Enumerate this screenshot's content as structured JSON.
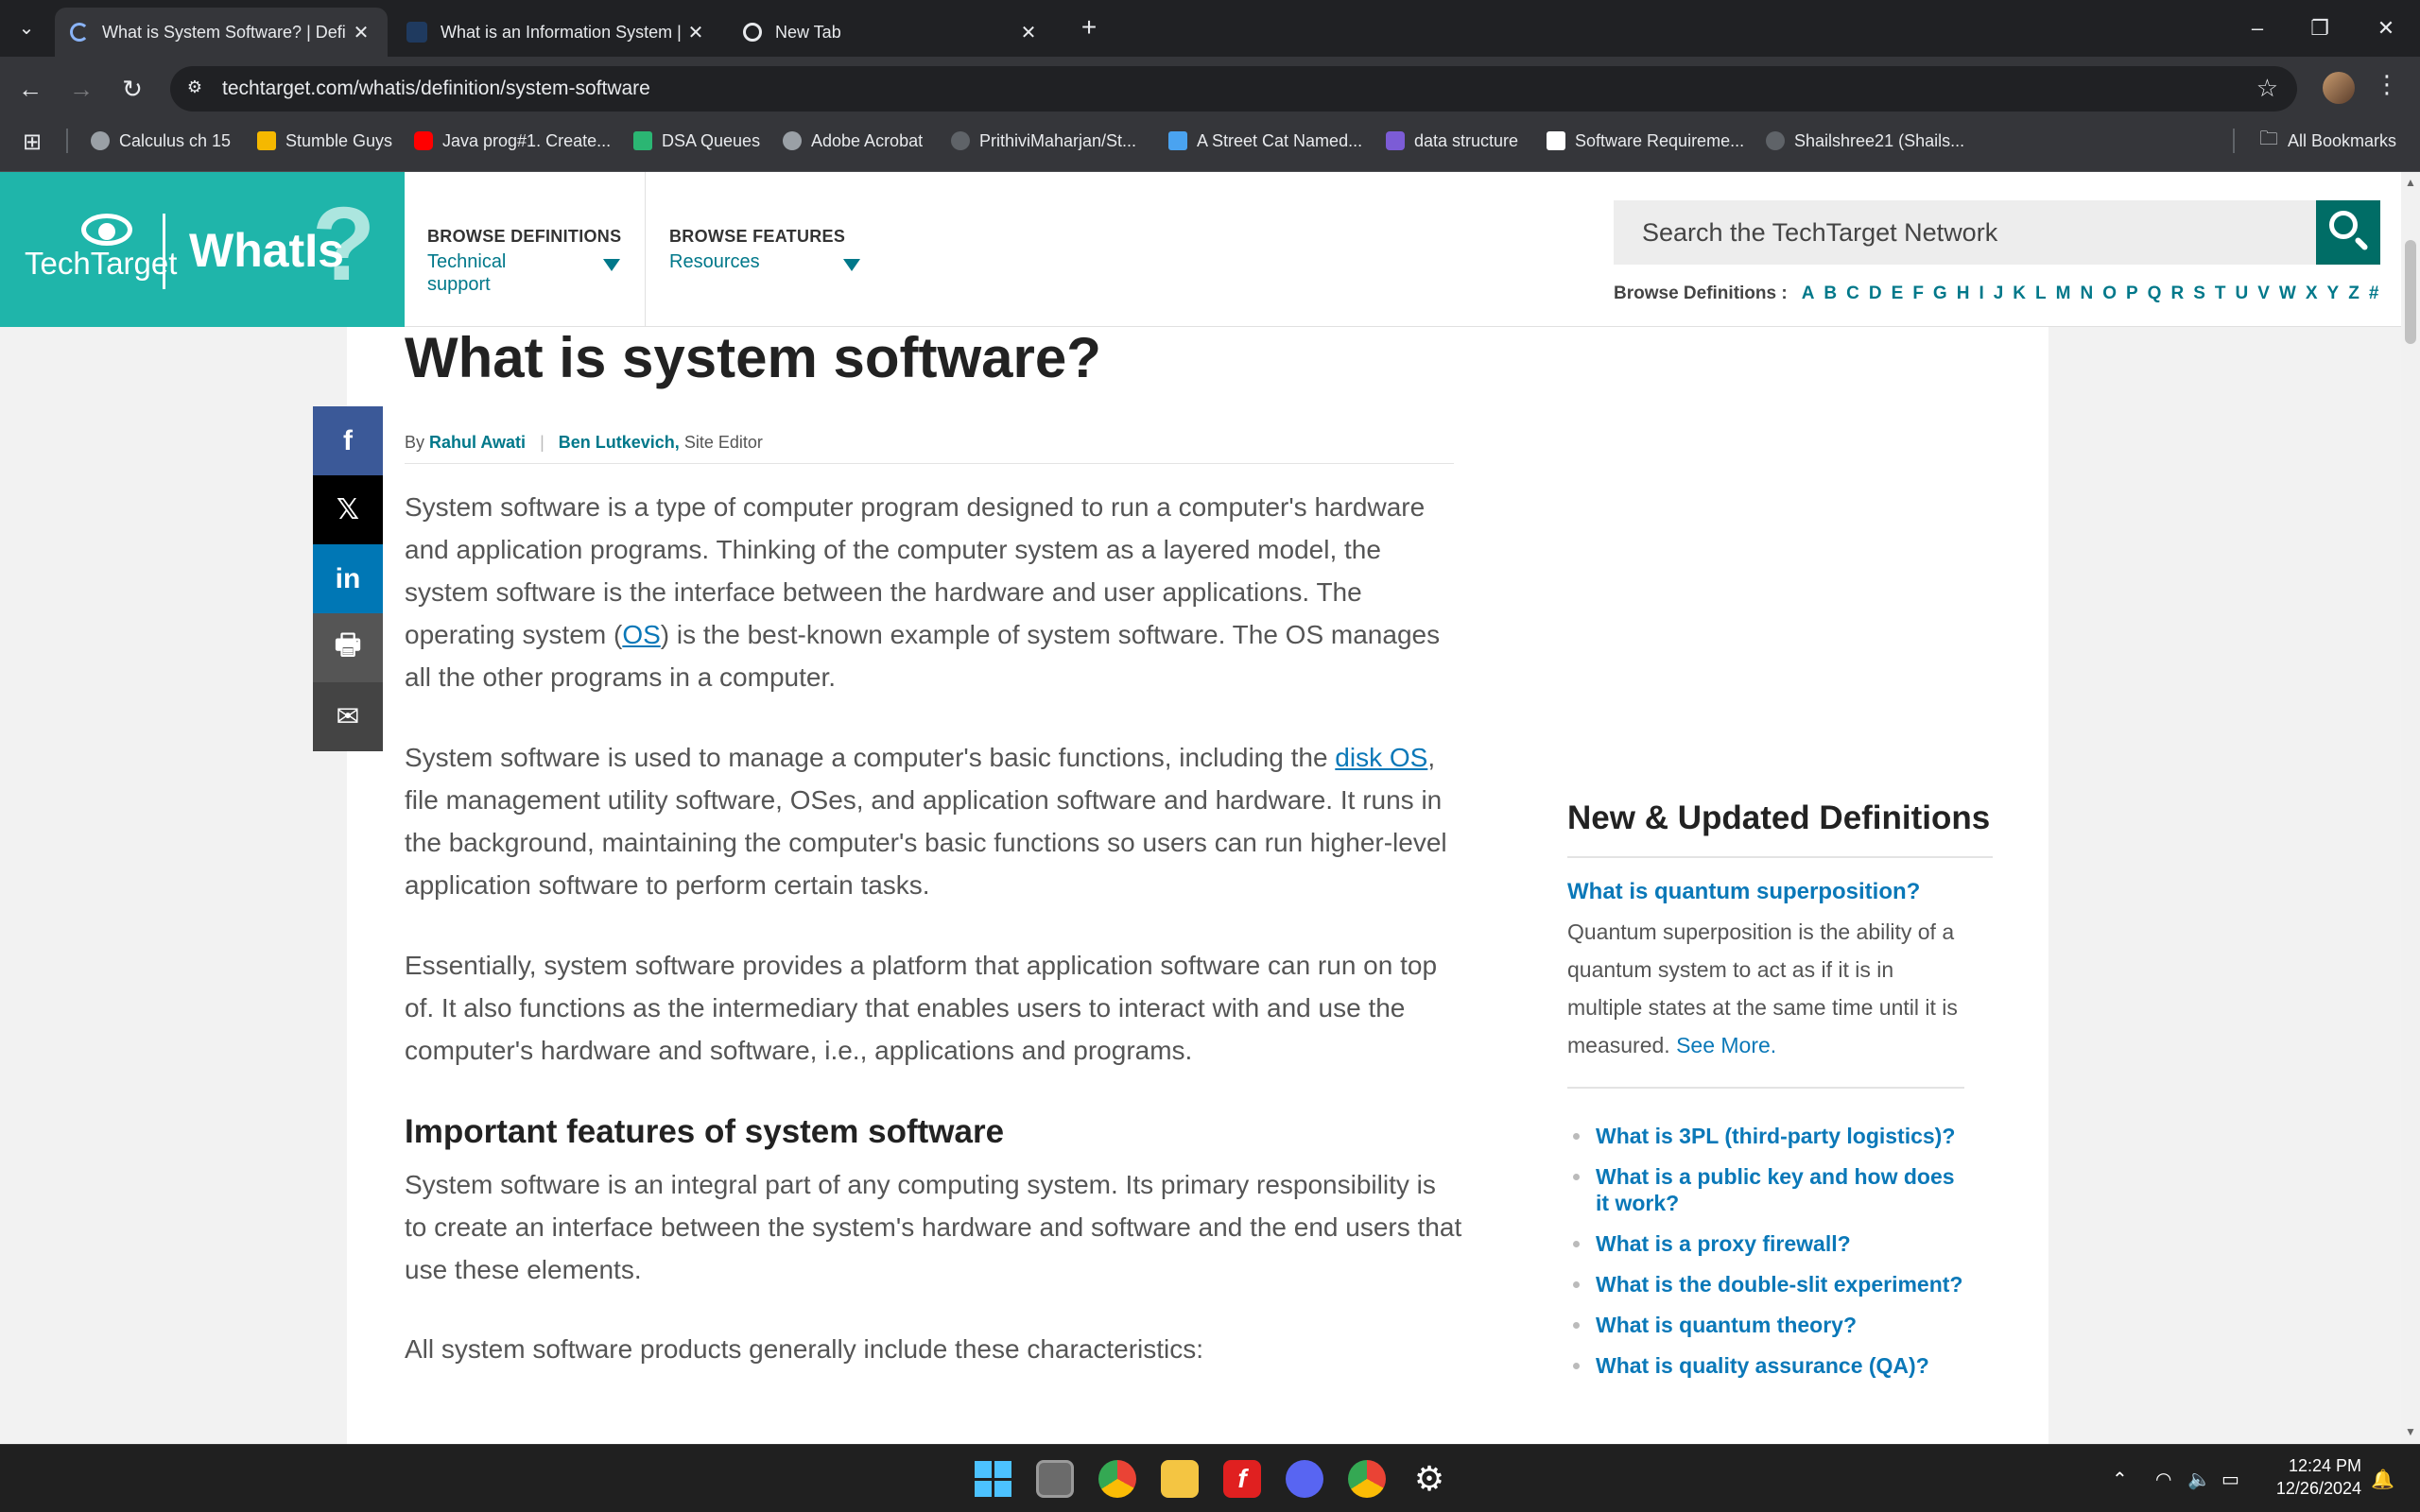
{
  "browser": {
    "tabs": [
      {
        "title": "What is System Software? | Defi",
        "active": true
      },
      {
        "title": "What is an Information System |",
        "active": false
      },
      {
        "title": "New Tab",
        "active": false
      }
    ],
    "url": "techtarget.com/whatis/definition/system-software",
    "bookmarks": [
      {
        "label": "Calculus ch 15",
        "icon_color": "#9aa0a6"
      },
      {
        "label": "Stumble Guys",
        "icon_color": "#f5b800"
      },
      {
        "label": "Java prog#1. Create...",
        "icon_color": "#ff0000"
      },
      {
        "label": "DSA Queues",
        "icon_color": "#2bb673"
      },
      {
        "label": "Adobe Acrobat",
        "icon_color": "#9aa0a6"
      },
      {
        "label": "PrithiviMaharjan/St...",
        "icon_color": "#5f6368"
      },
      {
        "label": "A Street Cat Named...",
        "icon_color": "#4aa3f0"
      },
      {
        "label": "data structure",
        "icon_color": "#7c5cd6"
      },
      {
        "label": "Software Requireme...",
        "icon_color": "#ffffff"
      },
      {
        "label": "Shailshree21 (Shails...",
        "icon_color": "#5f6368"
      }
    ],
    "all_bookmarks": "All Bookmarks"
  },
  "header": {
    "logo_techtarget": "TechTarget",
    "logo_whatis": "WhatIs",
    "logo_q": "?",
    "nav": [
      {
        "label": "BROWSE DEFINITIONS",
        "value": "Technical support"
      },
      {
        "label": "BROWSE FEATURES",
        "value": "Resources"
      }
    ],
    "search_placeholder": "Search the TechTarget Network",
    "browse_title": "Browse Definitions :",
    "letters": [
      "A",
      "B",
      "C",
      "D",
      "E",
      "F",
      "G",
      "H",
      "I",
      "J",
      "K",
      "L",
      "M",
      "N",
      "O",
      "P",
      "Q",
      "R",
      "S",
      "T",
      "U",
      "V",
      "W",
      "X",
      "Y",
      "Z",
      "#"
    ]
  },
  "article": {
    "title": "What is system software?",
    "by": "By",
    "author1": "Rahul Awati",
    "author2": "Ben Lutkevich,",
    "author2_role": "Site Editor",
    "p1_a": "System software is a type of computer program designed to run a computer's hardware and application programs. Thinking of the computer system as a layered model, the system software is the interface between the hardware and user applications. The operating system (",
    "p1_link": "OS",
    "p1_b": ") is the best-known example of system software. The OS manages all the other programs in a computer.",
    "p2_a": "System software is used to manage a computer's basic functions, including the ",
    "p2_link": "disk OS",
    "p2_b": ", file management utility software, OSes, and application software and hardware. It runs in the background, maintaining the computer's basic functions so users can run higher-level application software to perform certain tasks.",
    "p3": "Essentially, system software provides a platform that application software can run on top of. It also functions as the intermediary that enables users to interact with and use the computer's hardware and software, i.e., applications and programs.",
    "h2": "Important features of system software",
    "p4": "System software is an integral part of any computing system. Its primary responsibility is to create an interface between the system's hardware and software and the end users that use these elements.",
    "p5": "All system software products generally include these characteristics:"
  },
  "share": [
    {
      "icon": "facebook-icon",
      "glyph": "f",
      "color": "#3b5998"
    },
    {
      "icon": "x-icon",
      "glyph": "𝕏",
      "color": "#000000"
    },
    {
      "icon": "linkedin-icon",
      "glyph": "in",
      "color": "#0077b5"
    },
    {
      "icon": "print-icon",
      "glyph": "🖶",
      "color": "#555555"
    },
    {
      "icon": "email-icon",
      "glyph": "✉",
      "color": "#444444"
    }
  ],
  "sidebar": {
    "title": "New & Updated Definitions",
    "featured_title": "What is quantum superposition?",
    "featured_desc": "Quantum superposition is the ability of a quantum system to act as if it is in multiple states at the same time until it is measured. ",
    "see_more": "See More.",
    "items": [
      "What is 3PL (third-party logistics)?",
      "What is a public key and how does it work?",
      "What is a proxy firewall?",
      "What is the double-slit experiment?",
      "What is quantum theory?",
      "What is quality assurance (QA)?"
    ]
  },
  "taskbar": {
    "time": "12:24 PM",
    "date": "12/26/2024"
  }
}
